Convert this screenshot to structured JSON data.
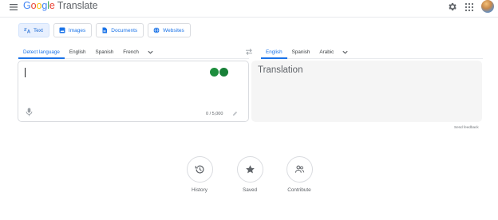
{
  "header": {
    "logo_google": "Google",
    "logo_product": "Translate",
    "icons": {
      "menu": "hamburger-menu-icon",
      "settings": "gear-icon",
      "apps": "apps-grid-icon",
      "account": "avatar"
    }
  },
  "modes": [
    {
      "label": "Text",
      "icon": "translate-icon",
      "active": true
    },
    {
      "label": "Images",
      "icon": "image-icon",
      "active": false
    },
    {
      "label": "Documents",
      "icon": "document-icon",
      "active": false
    },
    {
      "label": "Websites",
      "icon": "globe-icon",
      "active": false
    }
  ],
  "source_languages": [
    "Detect language",
    "English",
    "Spanish",
    "French"
  ],
  "target_languages": [
    "English",
    "Spanish",
    "Arabic"
  ],
  "source_box": {
    "value": "",
    "char_count": "0 / 5,000"
  },
  "target_box": {
    "placeholder": "Translation"
  },
  "feedback": "Send feedback",
  "bottom_actions": [
    {
      "label": "History",
      "icon": "history-icon"
    },
    {
      "label": "Saved",
      "icon": "star-icon"
    },
    {
      "label": "Contribute",
      "icon": "contribute-icon"
    }
  ],
  "colors": {
    "accent": "#1a73e8",
    "active_tab_bg": "#e8f0fe",
    "target_bg": "#f5f5f5"
  }
}
